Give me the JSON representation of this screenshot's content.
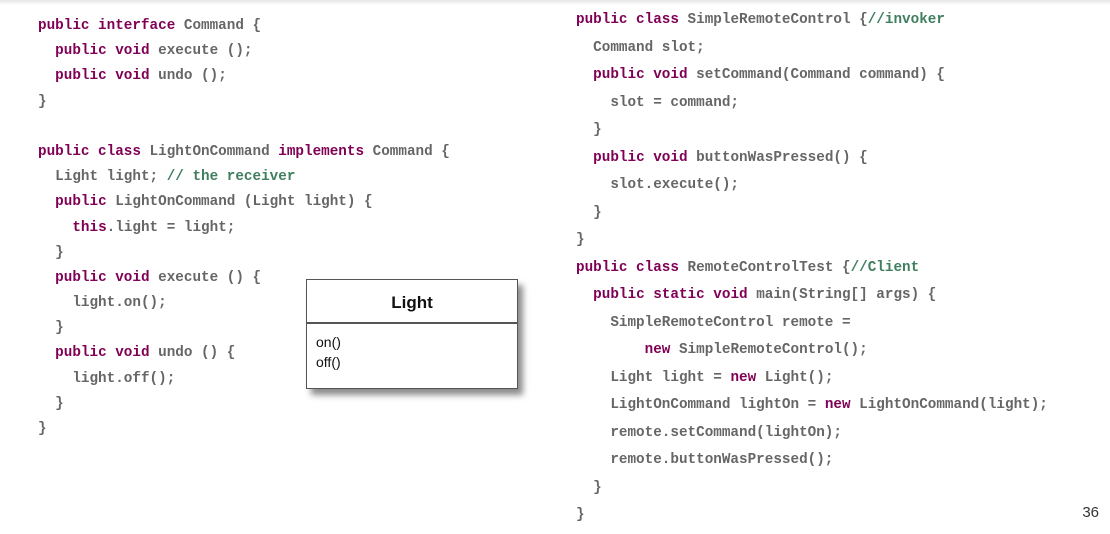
{
  "left_code": {
    "lines": [
      [
        {
          "t": "public interface ",
          "k": "kw"
        },
        {
          "t": "Command {",
          "k": ""
        }
      ],
      [
        {
          "t": "  ",
          "k": ""
        },
        {
          "t": "public void ",
          "k": "kw"
        },
        {
          "t": "execute ();",
          "k": ""
        }
      ],
      [
        {
          "t": "  ",
          "k": ""
        },
        {
          "t": "public void ",
          "k": "kw"
        },
        {
          "t": "undo ();",
          "k": ""
        }
      ],
      [
        {
          "t": "}",
          "k": ""
        }
      ],
      [
        {
          "t": "",
          "k": ""
        }
      ],
      [
        {
          "t": "public class ",
          "k": "kw"
        },
        {
          "t": "LightOnCommand ",
          "k": ""
        },
        {
          "t": "implements ",
          "k": "kw"
        },
        {
          "t": "Command {",
          "k": ""
        }
      ],
      [
        {
          "t": "  Light light; ",
          "k": ""
        },
        {
          "t": "// the receiver",
          "k": "cm"
        }
      ],
      [
        {
          "t": "  ",
          "k": ""
        },
        {
          "t": "public ",
          "k": "kw"
        },
        {
          "t": "LightOnCommand (Light light) {",
          "k": ""
        }
      ],
      [
        {
          "t": "    ",
          "k": ""
        },
        {
          "t": "this",
          "k": "kw"
        },
        {
          "t": ".light = light;",
          "k": ""
        }
      ],
      [
        {
          "t": "  }",
          "k": ""
        }
      ],
      [
        {
          "t": "  ",
          "k": ""
        },
        {
          "t": "public void ",
          "k": "kw"
        },
        {
          "t": "execute () {",
          "k": ""
        }
      ],
      [
        {
          "t": "    light.on();",
          "k": ""
        }
      ],
      [
        {
          "t": "  }",
          "k": ""
        }
      ],
      [
        {
          "t": "  ",
          "k": ""
        },
        {
          "t": "public void ",
          "k": "kw"
        },
        {
          "t": "undo () {",
          "k": ""
        }
      ],
      [
        {
          "t": "    light.off();",
          "k": ""
        }
      ],
      [
        {
          "t": "  }",
          "k": ""
        }
      ],
      [
        {
          "t": "}",
          "k": ""
        }
      ]
    ]
  },
  "right_code": {
    "lines": [
      [
        {
          "t": "public class ",
          "k": "kw"
        },
        {
          "t": "SimpleRemoteControl {",
          "k": ""
        },
        {
          "t": "//invoker",
          "k": "cm"
        }
      ],
      [
        {
          "t": "  Command slot;",
          "k": ""
        }
      ],
      [
        {
          "t": "  ",
          "k": ""
        },
        {
          "t": "public void ",
          "k": "kw"
        },
        {
          "t": "setCommand(Command command) {",
          "k": ""
        }
      ],
      [
        {
          "t": "    slot = command;",
          "k": ""
        }
      ],
      [
        {
          "t": "  }",
          "k": ""
        }
      ],
      [
        {
          "t": "  ",
          "k": ""
        },
        {
          "t": "public void ",
          "k": "kw"
        },
        {
          "t": "buttonWasPressed() {",
          "k": ""
        }
      ],
      [
        {
          "t": "    slot.execute();",
          "k": ""
        }
      ],
      [
        {
          "t": "  }",
          "k": ""
        }
      ],
      [
        {
          "t": "}",
          "k": ""
        }
      ],
      [
        {
          "t": "public class ",
          "k": "kw"
        },
        {
          "t": "RemoteControlTest {",
          "k": ""
        },
        {
          "t": "//Client",
          "k": "cm"
        }
      ],
      [
        {
          "t": "  ",
          "k": ""
        },
        {
          "t": "public static void ",
          "k": "kw"
        },
        {
          "t": "main(String[] args) {",
          "k": ""
        }
      ],
      [
        {
          "t": "    SimpleRemoteControl remote =",
          "k": ""
        }
      ],
      [
        {
          "t": "        ",
          "k": ""
        },
        {
          "t": "new ",
          "k": "kw"
        },
        {
          "t": "SimpleRemoteControl();",
          "k": ""
        }
      ],
      [
        {
          "t": "    Light light = ",
          "k": ""
        },
        {
          "t": "new ",
          "k": "kw"
        },
        {
          "t": "Light();",
          "k": ""
        }
      ],
      [
        {
          "t": "    LightOnCommand lightOn = ",
          "k": ""
        },
        {
          "t": "new ",
          "k": "kw"
        },
        {
          "t": "LightOnCommand(light);",
          "k": ""
        }
      ],
      [
        {
          "t": "    remote.setCommand(lightOn);",
          "k": ""
        }
      ],
      [
        {
          "t": "    remote.buttonWasPressed();",
          "k": ""
        }
      ],
      [
        {
          "t": "  }",
          "k": ""
        }
      ],
      [
        {
          "t": "}",
          "k": ""
        }
      ]
    ]
  },
  "uml": {
    "class_name": "Light",
    "methods": [
      "on()",
      "off()"
    ]
  },
  "page_number": "36",
  "colors": {
    "keyword": "#7f0055",
    "comment": "#3f7f5f",
    "text": "#666666"
  }
}
